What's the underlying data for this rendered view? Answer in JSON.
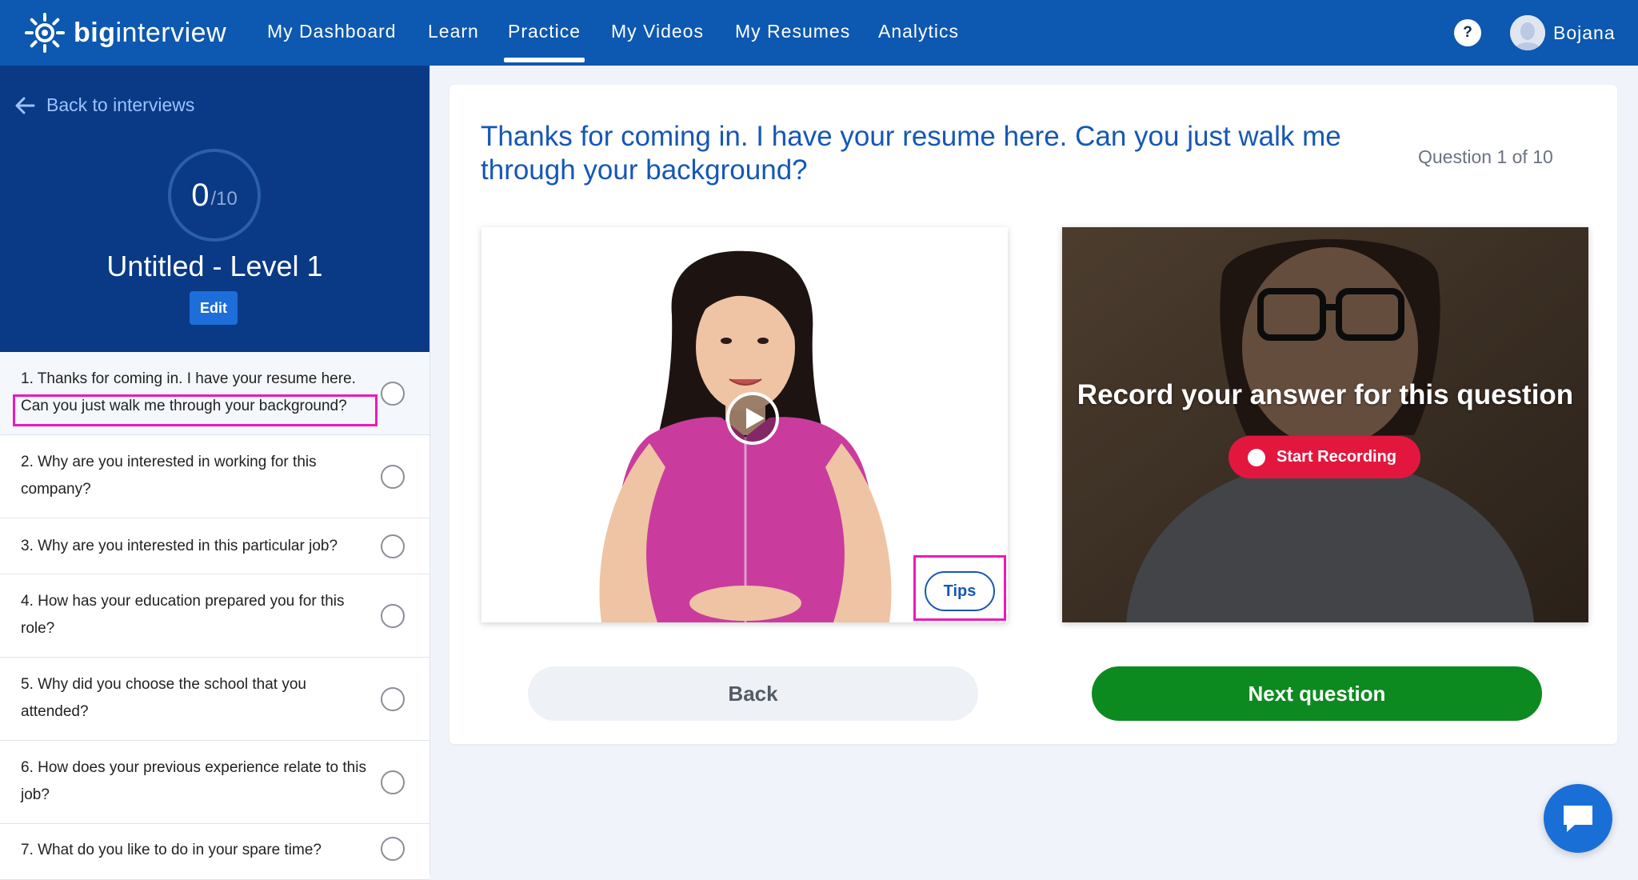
{
  "brand": {
    "name_bold": "big",
    "name_rest": "interview"
  },
  "nav": {
    "items": [
      {
        "label": "My Dashboard"
      },
      {
        "label": "Learn"
      },
      {
        "label": "Practice"
      },
      {
        "label": "My Videos"
      },
      {
        "label": "My Resumes"
      },
      {
        "label": "Analytics"
      }
    ],
    "active": "Practice",
    "help_label": "?",
    "user_name": "Bojana"
  },
  "sidebar": {
    "back_label": "Back to interviews",
    "score_done": "0",
    "score_total": "/10",
    "interview_title": "Untitled - Level 1",
    "edit_label": "Edit",
    "questions": [
      {
        "text": "1. Thanks for coming in. I have your resume here. Can you just walk me through your background?"
      },
      {
        "text": "2. Why are you interested in working for this company?"
      },
      {
        "text": "3. Why are you interested in this particular job?"
      },
      {
        "text": "4. How has your education prepared you for this role?"
      },
      {
        "text": "5. Why did you choose the school that you attended?"
      },
      {
        "text": "6. How does your previous experience relate to this job?"
      },
      {
        "text": "7. What do you like to do in your spare time?"
      }
    ]
  },
  "main": {
    "question": "Thanks for coming in. I have your resume here. Can you just walk me through your background?",
    "counter": "Question 1 of 10",
    "tips_label": "Tips",
    "record_prompt": "Record your answer for this question",
    "record_button": "Start Recording",
    "back_button": "Back",
    "next_button": "Next question"
  },
  "colors": {
    "nav_bg": "#0d58b0",
    "sidebar_head_bg": "#0a3a86",
    "accent_blue": "#1657b6",
    "record_red": "#e3173e",
    "next_green": "#0d8a1f",
    "highlight_magenta": "#ec1ab9"
  },
  "icons": [
    "sun-logo-icon",
    "help-icon",
    "avatar-icon",
    "arrow-left-icon",
    "play-icon",
    "record-dot-icon",
    "chat-icon"
  ]
}
